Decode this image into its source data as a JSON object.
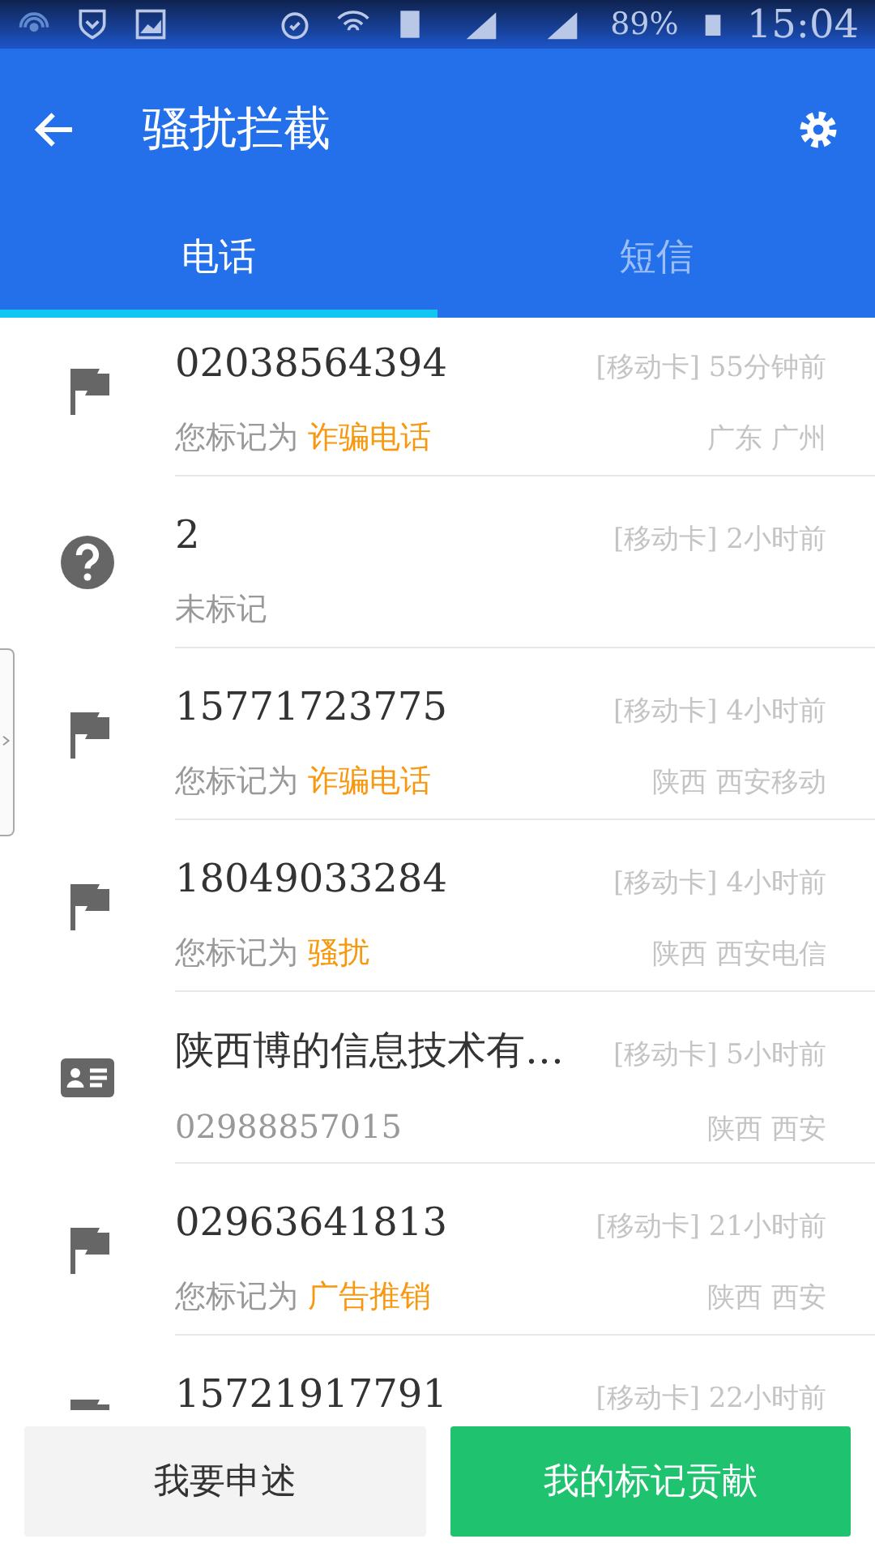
{
  "status_bar": {
    "battery": "89%",
    "time": "15:04"
  },
  "header": {
    "title": "骚扰拦截"
  },
  "tabs": [
    {
      "label": "电话",
      "selected": true
    },
    {
      "label": "短信",
      "selected": false
    }
  ],
  "calls": [
    {
      "kind": "flag",
      "title": "02038564394",
      "info": "[移动卡] 55分钟前",
      "note": "您标记为",
      "tag": "诈骗电话",
      "location": "广东 广州"
    },
    {
      "kind": "unknown",
      "title": "2",
      "info": "[移动卡] 2小时前",
      "note": "未标记"
    },
    {
      "kind": "flag",
      "title": "15771723775",
      "info": "[移动卡] 4小时前",
      "note": "您标记为",
      "tag": "诈骗电话",
      "location": "陕西 西安移动"
    },
    {
      "kind": "flag",
      "title": "18049033284",
      "info": "[移动卡] 4小时前",
      "note": "您标记为",
      "tag": "骚扰",
      "location": "陕西 西安电信"
    },
    {
      "kind": "contact",
      "title": "陕西博的信息技术有…",
      "info": "[移动卡] 5小时前",
      "number": "02988857015",
      "location": "陕西 西安"
    },
    {
      "kind": "flag",
      "title": "02963641813",
      "info": "[移动卡] 21小时前",
      "note": "您标记为",
      "tag": "广告推销",
      "location": "陕西 西安"
    },
    {
      "kind": "flag",
      "title": "15721917791",
      "info": "[移动卡] 22小时前"
    }
  ],
  "buttons": [
    {
      "label": "我要申述",
      "kind": "secondary"
    },
    {
      "label": "我的标记贡献",
      "kind": "primary"
    }
  ]
}
